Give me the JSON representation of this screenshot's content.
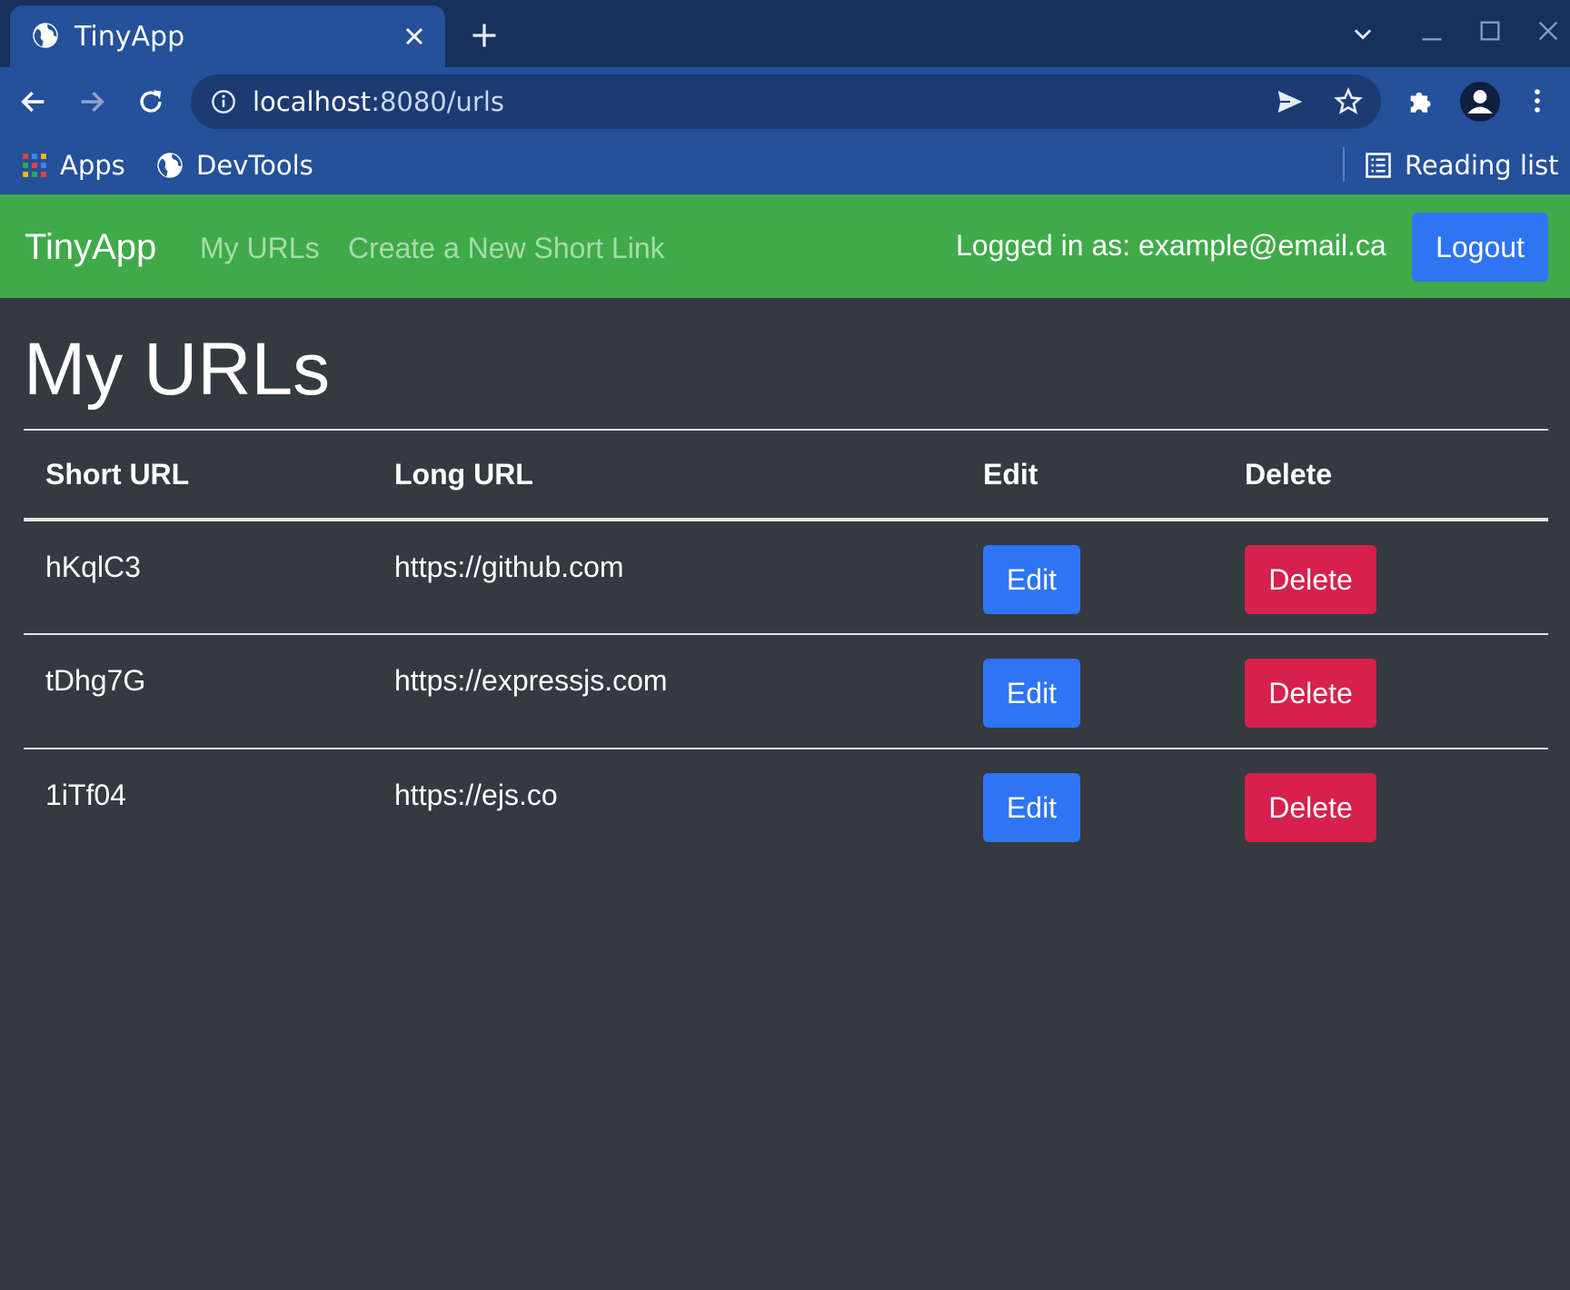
{
  "browser": {
    "tab_title": "TinyApp",
    "url_host": "localhost",
    "url_rest": ":8080/urls",
    "bookmarks": {
      "apps_label": "Apps",
      "devtools_label": "DevTools",
      "reading_list_label": "Reading list"
    }
  },
  "navbar": {
    "brand": "TinyApp",
    "links": [
      "My URLs",
      "Create a New Short Link"
    ],
    "logged_in_text": "Logged in as: example@email.ca",
    "logout_label": "Logout"
  },
  "main": {
    "title": "My URLs",
    "table": {
      "headers": [
        "Short URL",
        "Long URL",
        "Edit",
        "Delete"
      ],
      "rows": [
        {
          "short": "hKqlC3",
          "long": "https://github.com",
          "edit": "Edit",
          "delete": "Delete"
        },
        {
          "short": "tDhg7G",
          "long": "https://expressjs.com",
          "edit": "Edit",
          "delete": "Delete"
        },
        {
          "short": "1iTf04",
          "long": "https://ejs.co",
          "edit": "Edit",
          "delete": "Delete"
        }
      ]
    }
  },
  "colors": {
    "navbar": "#40aa4a",
    "page_background": "#343a40",
    "primary_button": "#2f74f5",
    "danger_button": "#d6204d",
    "chrome_frame": "#17305d",
    "chrome_toolbar": "#25509a"
  }
}
